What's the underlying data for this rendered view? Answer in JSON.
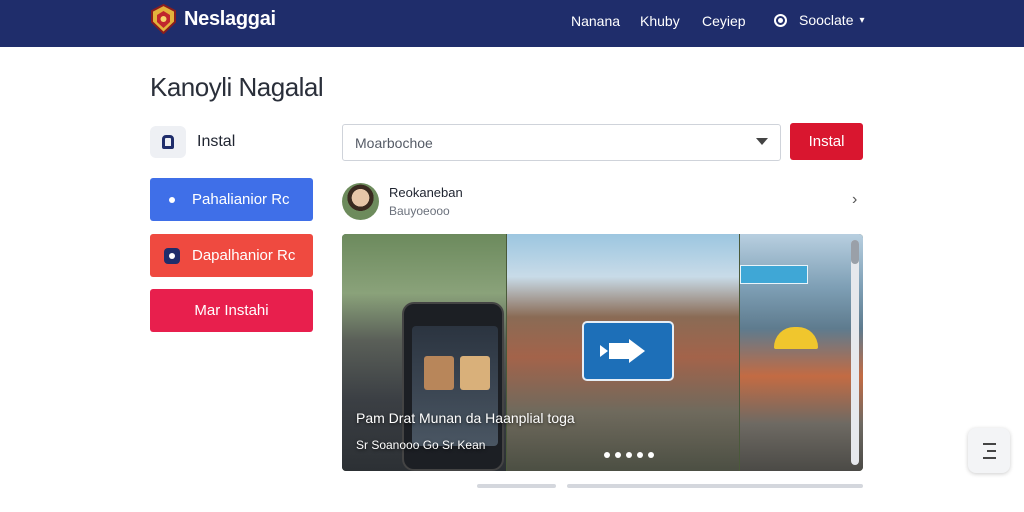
{
  "brand": {
    "name": "Neslaggai"
  },
  "nav": {
    "links": [
      "Nanana",
      "Khuby",
      "Ceyiep"
    ],
    "user_label": "Sooclate"
  },
  "page": {
    "title": "Kanoyli Nagalal"
  },
  "sidebar": {
    "install_label": "Instal",
    "buttons": [
      {
        "label": "Pahalianior Rc",
        "color": "#3f6fe8"
      },
      {
        "label": "Dapalhanior Rc",
        "color": "#ef4a40"
      },
      {
        "label": "Mar Instahi",
        "color": "#e81f4d"
      }
    ]
  },
  "search": {
    "value": "Moarbochoe",
    "install_button": "Instal"
  },
  "post": {
    "author_name": "Reokaneban",
    "author_sub": "Bauyoeooo",
    "caption_title": "Pam Drat Munan da Haanplial toga",
    "caption_sub": "Sr Soanooo Go Sr Kean"
  },
  "colors": {
    "header": "#1f2d6b",
    "accent": "#d9162f"
  }
}
